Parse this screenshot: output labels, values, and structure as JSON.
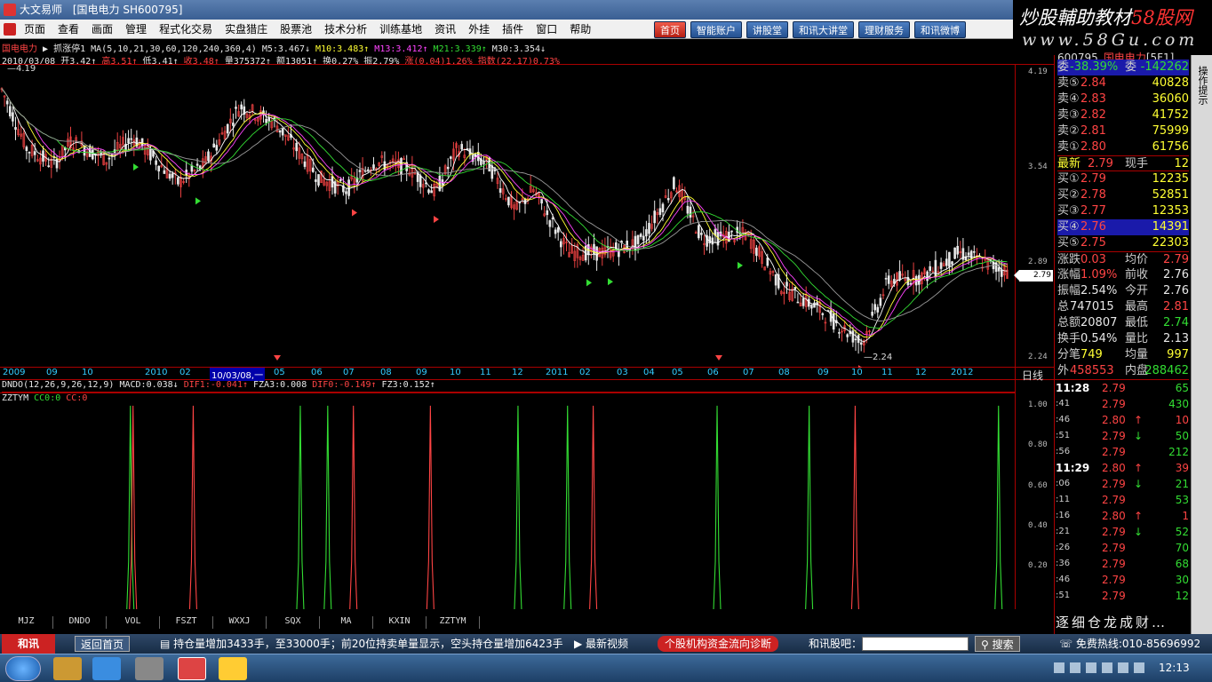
{
  "window": {
    "title_app": "大文易师",
    "title_stock": "[国电电力 SH600795]"
  },
  "watermark": {
    "line1a": "炒股輔助教材",
    "line1b": "58股网",
    "line2": "www.58Gu.com"
  },
  "menu": [
    "页面",
    "查看",
    "画面",
    "管理",
    "程式化交易",
    "实盘猎庄",
    "股票池",
    "技术分析",
    "训练基地",
    "资讯",
    "外挂",
    "插件",
    "窗口",
    "帮助"
  ],
  "topbuttons": [
    "首页",
    "智能账户",
    "讲股堂",
    "和讯大讲堂",
    "理财服务",
    "和讯微博"
  ],
  "info1": {
    "name": "国电电力",
    "flag": "▶",
    "limit": "抓涨停1",
    "ma": "MA(5,10,21,30,60,120,240,360,4)",
    "m5": "M5:3.467↓",
    "m10": "M10:3.483↑",
    "m13": "M13:3.412↑",
    "m21": "M21:3.339↑",
    "m30": "M30:3.354↓"
  },
  "info2": {
    "date": "2010/03/08",
    "open": "开3.42↑",
    "high": "高3.51↑",
    "low": "低3.41↑",
    "close": "收3.48↑",
    "vol": "量375372↑",
    "amt": "额13051↑",
    "turn": "换0.27%",
    "amp": "振2.79%",
    "chg": "涨(0.04)1.26%",
    "index": "指数(22.17)0.73%"
  },
  "price_axis": [
    "4.19",
    "3.54",
    "2.89",
    "2.24"
  ],
  "price_tag": "2.79",
  "hi_label": "4.19",
  "lo_label": "2.24",
  "time_axis": [
    "2009",
    "09",
    "10",
    "2010",
    "02",
    "03",
    "05",
    "06",
    "07",
    "08",
    "09",
    "10",
    "11",
    "12",
    "2011",
    "02",
    "03",
    "04",
    "05",
    "06",
    "07",
    "08",
    "09",
    "10",
    "11",
    "12",
    "2012"
  ],
  "selected_date": "10/03/08,一",
  "period": "日线",
  "ind1": {
    "a": "DNDO(12,26,9,26,12,9)",
    "b": "MACD:0.038↓",
    "c": "DIF1:-0.041↑",
    "d": "FZA3:0.008",
    "e": "DIF0:-0.149↑",
    "f": "FZ3:0.152↑"
  },
  "ind2": {
    "a": "ZZTYM",
    "b": "CC0:0",
    "c": "CC:0"
  },
  "sub_axis": [
    "1.00",
    "0.80",
    "0.60",
    "0.40",
    "0.20"
  ],
  "bottom_tabs": [
    "MJZ",
    "DNDO",
    "VOL",
    "FSZT",
    "WXXJ",
    "SQX",
    "MA",
    "KXIN",
    "ZZTYM"
  ],
  "quote": {
    "header": {
      "code": "600795",
      "name": "国电电力",
      "suffix": "[5F1]"
    },
    "ratio": {
      "label": "委",
      "val": "-38.39%",
      "label2": "委",
      "val2": "-142262"
    },
    "sell": [
      {
        "l": "卖⑤",
        "p": "2.84",
        "v": "40828"
      },
      {
        "l": "卖④",
        "p": "2.83",
        "v": "36060"
      },
      {
        "l": "卖③",
        "p": "2.82",
        "v": "41752"
      },
      {
        "l": "卖②",
        "p": "2.81",
        "v": "75999"
      },
      {
        "l": "卖①",
        "p": "2.80",
        "v": "61756"
      }
    ],
    "last": {
      "l": "最新",
      "p": "2.79",
      "l2": "现手",
      "v": "12"
    },
    "buy": [
      {
        "l": "买①",
        "p": "2.79",
        "v": "12235"
      },
      {
        "l": "买②",
        "p": "2.78",
        "v": "52851"
      },
      {
        "l": "买③",
        "p": "2.77",
        "v": "12353"
      },
      {
        "l": "买④",
        "p": "2.76",
        "v": "14391"
      },
      {
        "l": "买⑤",
        "p": "2.75",
        "v": "22303"
      }
    ],
    "stats": [
      {
        "l": "涨跌",
        "v": "0.03",
        "l2": "均价",
        "v2": "2.79"
      },
      {
        "l": "涨幅",
        "v": "1.09%",
        "l2": "前收",
        "v2": "2.76"
      },
      {
        "l": "振幅",
        "v": "2.54%",
        "l2": "今开",
        "v2": "2.76"
      },
      {
        "l": "总",
        "v": "747015",
        "l2": "最高",
        "v2": "2.81"
      },
      {
        "l": "总额",
        "v": "20807",
        "l2": "最低",
        "v2": "2.74"
      },
      {
        "l": "换手",
        "v": "0.54%",
        "l2": "量比",
        "v2": "2.13"
      },
      {
        "l": "分笔",
        "v": "749",
        "l2": "均量",
        "v2": "997"
      },
      {
        "l": "外",
        "v": "458553",
        "l2": "内盘",
        "v2": "288462"
      }
    ]
  },
  "ticks": [
    {
      "t": "11:28",
      "p": "2.79",
      "a": "",
      "v": "65"
    },
    {
      "t": ":41",
      "p": "2.79",
      "a": "",
      "v": "430"
    },
    {
      "t": ":46",
      "p": "2.80",
      "a": "↑",
      "v": "10"
    },
    {
      "t": ":51",
      "p": "2.79",
      "a": "↓",
      "v": "50"
    },
    {
      "t": ":56",
      "p": "2.79",
      "a": "",
      "v": "212"
    },
    {
      "t": "11:29",
      "p": "2.80",
      "a": "↑",
      "v": "39"
    },
    {
      "t": ":06",
      "p": "2.79",
      "a": "↓",
      "v": "21"
    },
    {
      "t": ":11",
      "p": "2.79",
      "a": "",
      "v": "53"
    },
    {
      "t": ":16",
      "p": "2.80",
      "a": "↑",
      "v": "1"
    },
    {
      "t": ":21",
      "p": "2.79",
      "a": "↓",
      "v": "52"
    },
    {
      "t": ":26",
      "p": "2.79",
      "a": "",
      "v": "70"
    },
    {
      "t": ":36",
      "p": "2.79",
      "a": "",
      "v": "68"
    },
    {
      "t": ":46",
      "p": "2.79",
      "a": "",
      "v": "30"
    },
    {
      "t": ":51",
      "p": "2.79",
      "a": "",
      "v": "12"
    }
  ],
  "bottom_links": "逐细仓龙成财…",
  "side_tab": "操作提示",
  "status": {
    "logo": "和讯",
    "home": "返回首页",
    "news": "持仓量增加3433手，至33000手；前20位持卖单量显示，空头持仓量增加6423手",
    "video": "最新视频",
    "diag": "个股机构资金流向诊断",
    "forum": "和讯股吧：",
    "search": "搜索",
    "hotline": "免费热线:010-85696992"
  },
  "taskbar": {
    "clock": "12:13"
  },
  "colors": {
    "up": "#ff4444",
    "down": "#33dd33",
    "axis_frame": "#aa0000",
    "bg": "#000000"
  }
}
